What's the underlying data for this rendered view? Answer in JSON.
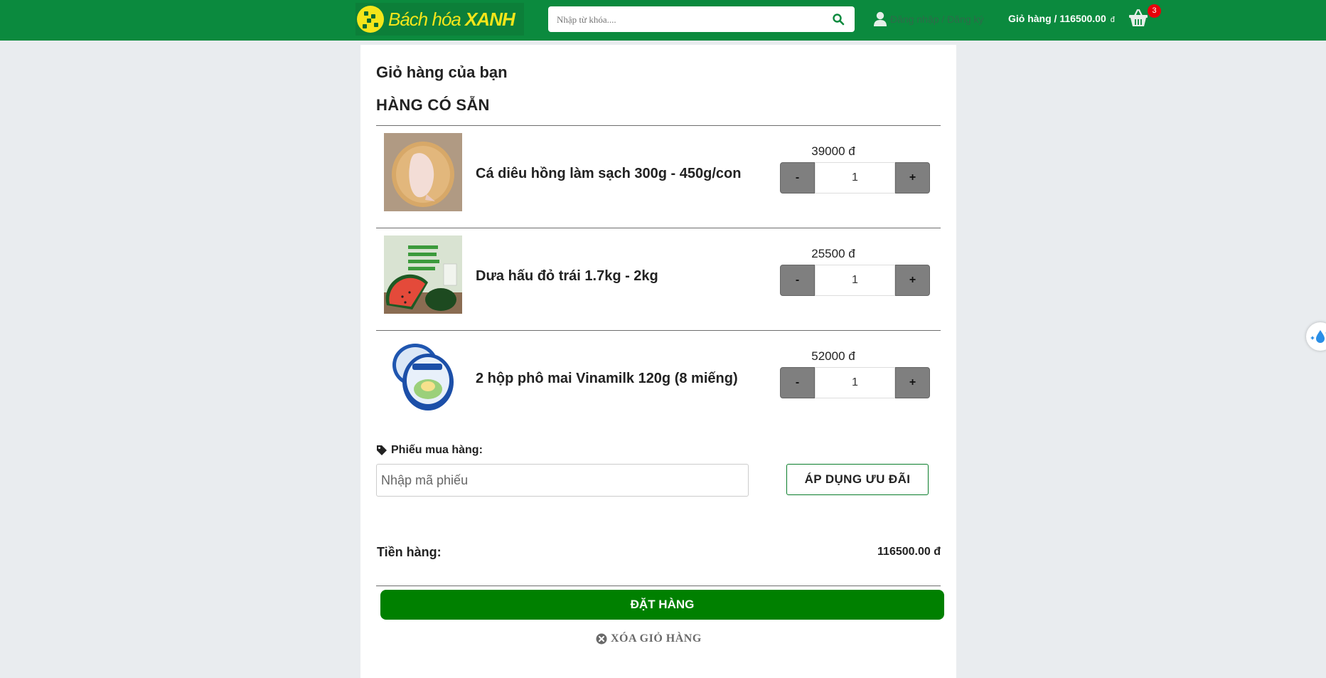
{
  "header": {
    "logo_text_regular": "Bách hóa ",
    "logo_text_bold": "XANH",
    "search_placeholder": "Nhập từ khóa....",
    "login_label": "Đăng nhập / Đăng ký",
    "cart_label": "Giỏ hàng / 116500.00",
    "cart_currency": "đ",
    "cart_badge": "3",
    "colors": {
      "brand": "#0b8a3e",
      "logo_yellow": "#f4e51a",
      "badge": "#e8000b"
    }
  },
  "cart": {
    "title": "Giỏ hàng của bạn",
    "section_title": "HÀNG CÓ SẴN",
    "items": [
      {
        "name": "Cá diêu hồng làm sạch 300g - 450g/con",
        "price": "39000 đ",
        "qty": "1",
        "image": "fish-image"
      },
      {
        "name": "Dưa hấu đỏ trái 1.7kg - 2kg",
        "price": "25500 đ",
        "qty": "1",
        "image": "watermelon-image"
      },
      {
        "name": "2 hộp phô mai Vinamilk 120g (8 miếng)",
        "price": "52000 đ",
        "qty": "1",
        "image": "cheese-image"
      }
    ],
    "qty_minus": "-",
    "qty_plus": "+",
    "coupon": {
      "label": "Phiếu mua hàng:",
      "placeholder": "Nhập mã phiếu",
      "apply_label": "ÁP DỤNG ƯU ĐÃI"
    },
    "subtotal_label": "Tiền hàng:",
    "subtotal_value": "116500.00 đ",
    "order_label": "ĐẶT HÀNG",
    "clear_label": "XÓA GIỎ HÀNG",
    "colors": {
      "order_button": "#008000",
      "qty_button": "#7f7f7f"
    }
  }
}
